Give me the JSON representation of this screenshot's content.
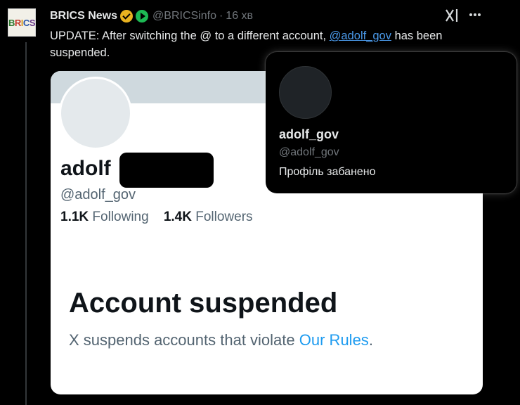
{
  "author": {
    "name": "BRICS News",
    "handle": "@BRICSinfo",
    "time": "16 хв",
    "avatar_text": [
      "B",
      "R",
      "I",
      "C",
      "S"
    ],
    "badges": [
      "gold-verified-badge",
      "green-play-badge"
    ]
  },
  "icons": {
    "grok": "grok-icon",
    "more": "more-icon"
  },
  "tweet": {
    "text_before": "UPDATE: After switching the @ to a different account, ",
    "mention": "@adolf_gov",
    "text_after": " has been suspended."
  },
  "embedded_profile": {
    "name_visible": "adolf",
    "handle": "@adolf_gov",
    "following_count": "1.1K",
    "following_label": "Following",
    "followers_count": "1.4K",
    "followers_label": "Followers",
    "title": "Account suspended",
    "subtitle_before": "X suspends accounts that violate ",
    "subtitle_link": "Our Rules",
    "subtitle_after": "."
  },
  "hover_card": {
    "name": "adolf_gov",
    "handle": "@adolf_gov",
    "status": "Профіль забанено"
  },
  "colors": {
    "background": "#000000",
    "mention_link": "#4a99e9",
    "rules_link": "#1d9bf0",
    "verified_gold": "#e8b220",
    "play_green": "#1db954"
  }
}
